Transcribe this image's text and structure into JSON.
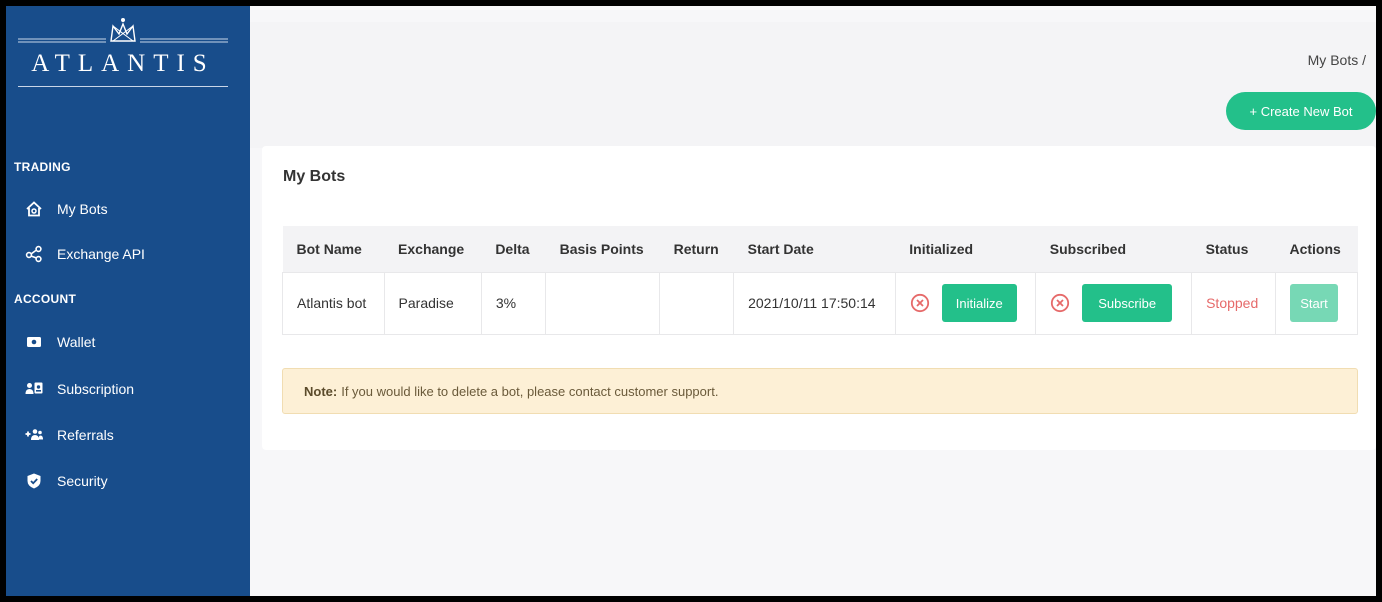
{
  "brand": {
    "name": "ATLANTIS",
    "logo_icon": "crown-mark-icon"
  },
  "sidebar": {
    "sections": [
      {
        "title": "TRADING",
        "items": [
          {
            "label": "My Bots",
            "icon": "home-icon"
          },
          {
            "label": "Exchange API",
            "icon": "share-icon"
          }
        ]
      },
      {
        "title": "ACCOUNT",
        "items": [
          {
            "label": "Wallet",
            "icon": "wallet-icon"
          },
          {
            "label": "Subscription",
            "icon": "subscription-icon"
          },
          {
            "label": "Referrals",
            "icon": "add-users-icon"
          },
          {
            "label": "Security",
            "icon": "shield-icon"
          }
        ]
      }
    ]
  },
  "header": {
    "breadcrumb": "My Bots  /",
    "create_button": "+  Create New Bot"
  },
  "card": {
    "title": "My Bots",
    "columns": [
      "Bot Name",
      "Exchange",
      "Delta",
      "Basis Points",
      "Return",
      "Start Date",
      "Initialized",
      "Subscribed",
      "Status",
      "Actions"
    ],
    "rows": [
      {
        "bot_name": "Atlantis bot",
        "exchange": "Paradise",
        "delta": "3%",
        "basis_points": "",
        "return": "",
        "start_date": "2021/10/11 17:50:14",
        "initialize_label": "Initialize",
        "subscribe_label": "Subscribe",
        "status": "Stopped",
        "action_label": "Start"
      }
    ],
    "note_label": "Note:",
    "note_text": "If you would like to delete a bot, please contact customer support."
  },
  "colors": {
    "sidebar": "#184d8b",
    "accent": "#23c08a",
    "danger": "#e66a6a",
    "note_bg": "#fdf0d6"
  }
}
